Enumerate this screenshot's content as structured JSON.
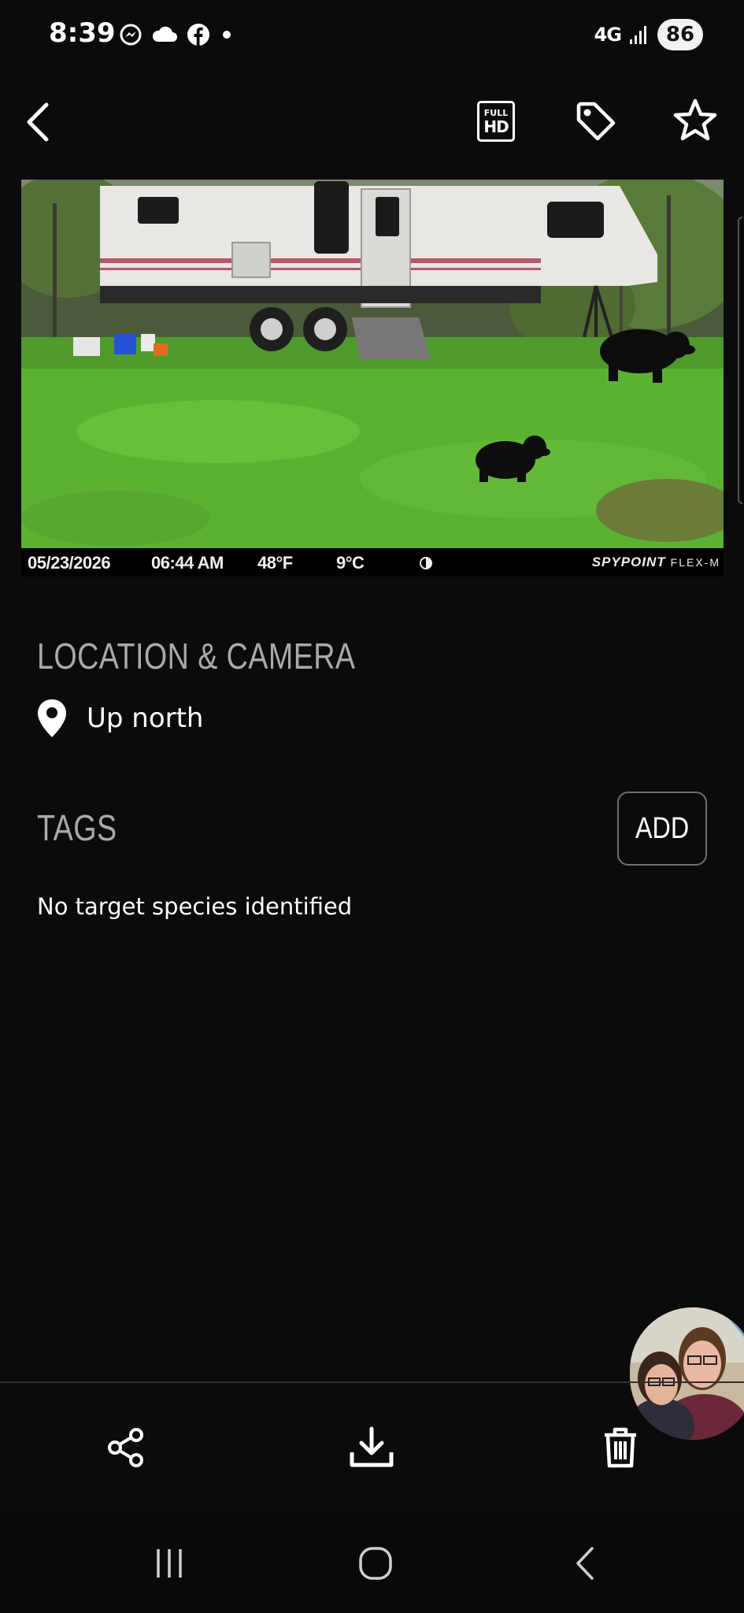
{
  "status_bar": {
    "time": "8:39",
    "left_icons": [
      "messenger-icon",
      "cloud-icon",
      "facebook-icon",
      "dot-icon"
    ],
    "network": "4G",
    "signal_icon": "signal-bars-icon",
    "battery": "86"
  },
  "top_bar": {
    "back_icon": "chevron-left-icon",
    "fullhd_line1": "FULL",
    "fullhd_line2": "HD",
    "tag_icon": "tag-icon",
    "star_icon": "star-outline-icon"
  },
  "photo": {
    "date": "05/23/2026",
    "time": "06:44 AM",
    "temp_f": "48°F",
    "temp_c": "9°C",
    "moon_icon": "moon-phase-icon",
    "brand": "SPYPOINT",
    "model": "FLEX-M"
  },
  "location_section": {
    "heading": "LOCATION & CAMERA",
    "icon": "map-pin-icon",
    "location_name": "Up north"
  },
  "tags_section": {
    "heading": "TAGS",
    "add_label": "ADD",
    "empty_text": "No target species identified"
  },
  "bottom_actions": {
    "share_icon": "share-icon",
    "download_icon": "download-icon",
    "delete_icon": "trash-icon"
  },
  "nav_bar": {
    "recents_icon": "recents-icon",
    "home_icon": "home-icon",
    "back_icon": "back-icon"
  }
}
